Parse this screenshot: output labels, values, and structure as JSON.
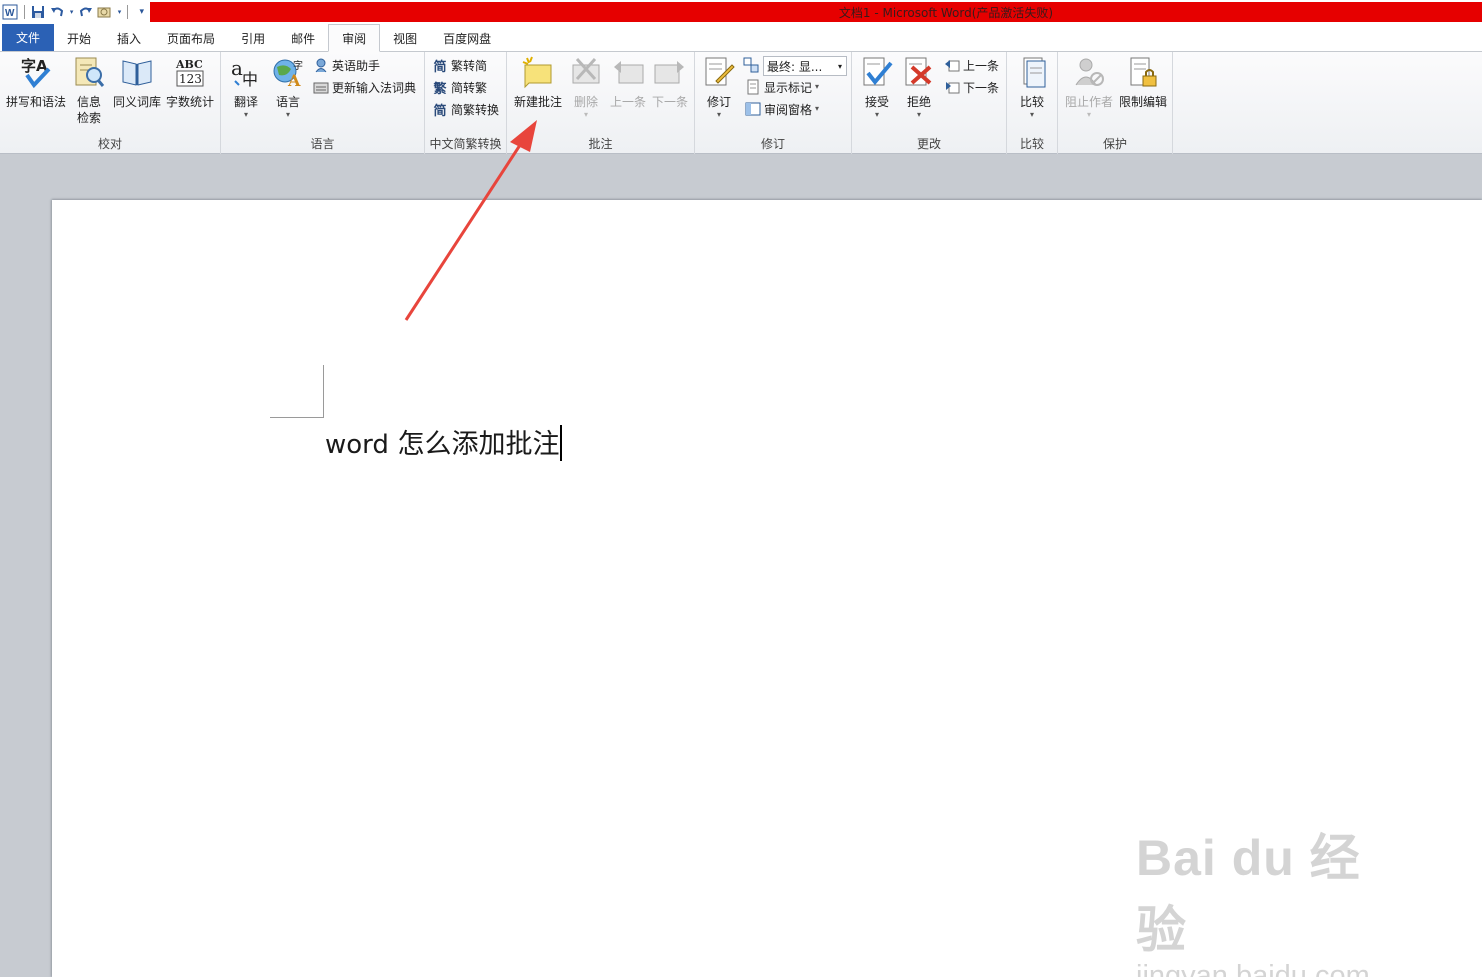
{
  "window": {
    "title": "文档1 - Microsoft Word(产品激活失败)"
  },
  "quick_access": {
    "icons": [
      "word-app-icon",
      "save-icon",
      "undo-icon",
      "redo-icon",
      "customize-icon"
    ]
  },
  "tabs": [
    {
      "label": "文件"
    },
    {
      "label": "开始"
    },
    {
      "label": "插入"
    },
    {
      "label": "页面布局"
    },
    {
      "label": "引用"
    },
    {
      "label": "邮件"
    },
    {
      "label": "审阅"
    },
    {
      "label": "视图"
    },
    {
      "label": "百度网盘"
    }
  ],
  "active_tab": "审阅",
  "ribbon": {
    "proofing": {
      "label": "校对",
      "spelling": "拼写和语法",
      "research1": "信息",
      "research2": "检索",
      "thesaurus": "同义词库",
      "wordcount": "字数统计"
    },
    "language": {
      "label": "语言",
      "translate": "翻译",
      "language": "语言",
      "english_assistant": "英语助手",
      "update_ime": "更新输入法词典"
    },
    "chinese_conversion": {
      "label": "中文简繁转换",
      "trad_to_simp": "繁转简",
      "simp_to_trad": "简转繁",
      "convert": "简繁转换"
    },
    "comments": {
      "label": "批注",
      "new_comment": "新建批注",
      "delete": "删除",
      "previous": "上一条",
      "next": "下一条"
    },
    "tracking": {
      "label": "修订",
      "track_changes": "修订",
      "display_mode": "最终: 显...",
      "show_markup": "显示标记",
      "reviewing_pane": "审阅窗格"
    },
    "changes": {
      "label": "更改",
      "accept": "接受",
      "reject": "拒绝",
      "previous": "上一条",
      "next": "下一条"
    },
    "compare": {
      "label": "比较",
      "compare": "比较"
    },
    "protect": {
      "label": "保护",
      "block_authors": "阻止作者",
      "restrict_editing": "限制编辑"
    }
  },
  "document": {
    "text_latin": "word",
    "text_cn": " 怎么添加批注"
  },
  "watermark": {
    "logo": "Bai du 经验",
    "url": "jingyan.baidu.com"
  },
  "colors": {
    "accent": "#2b61b5",
    "title_bar": "#e60000",
    "annotation_arrow": "#e8453c"
  }
}
